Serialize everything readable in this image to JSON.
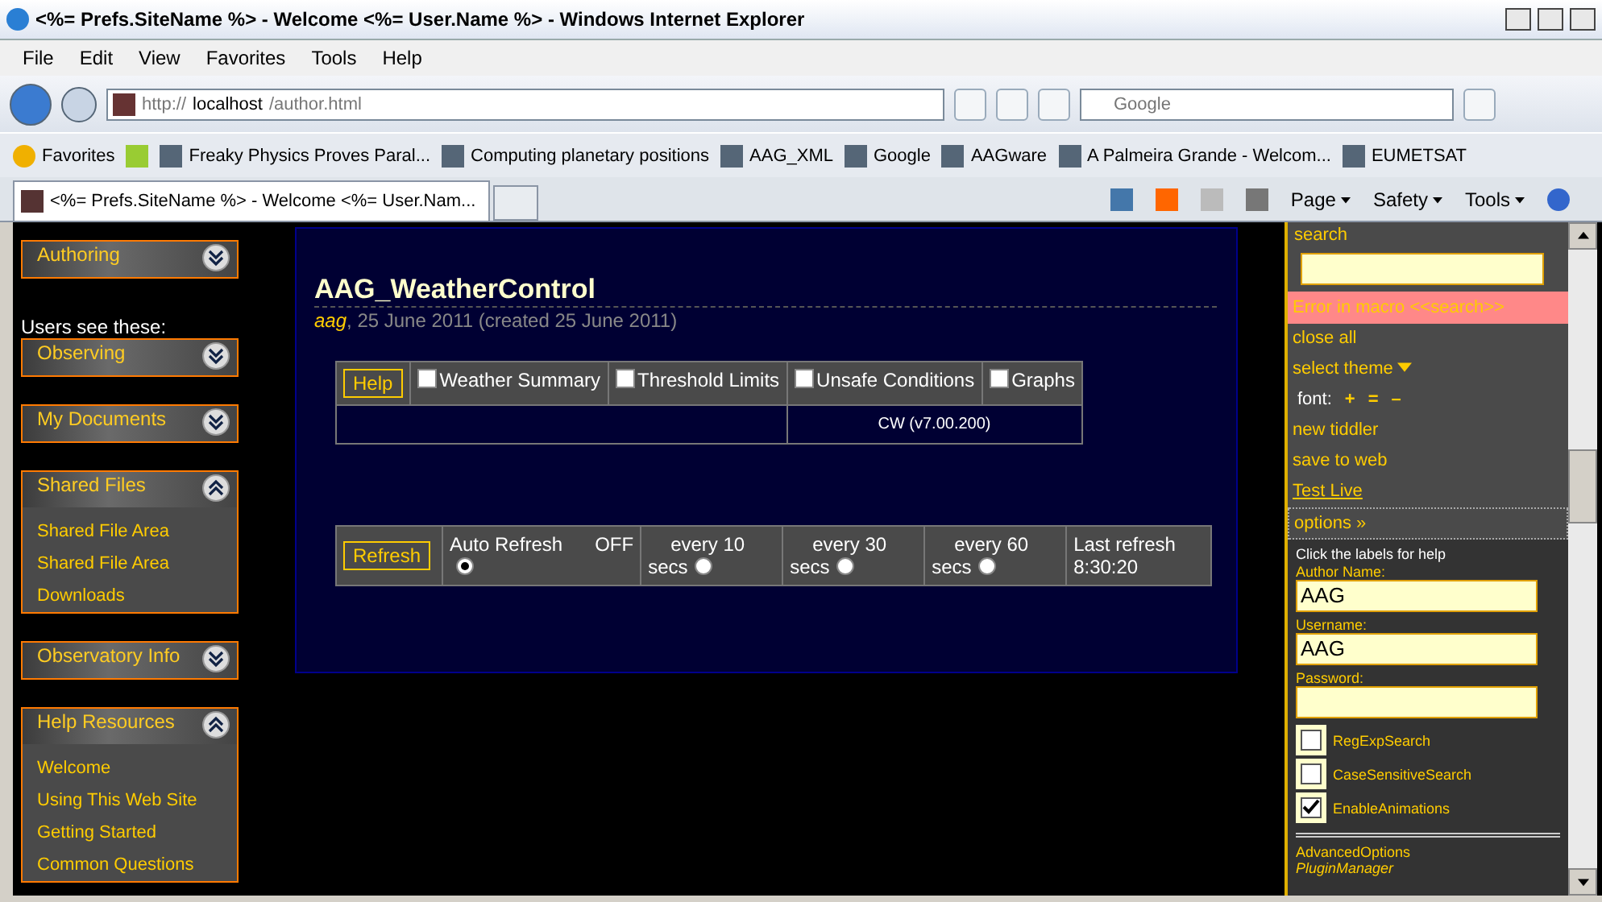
{
  "window": {
    "title": "<%= Prefs.SiteName %> - Welcome <%= User.Name %> - Windows Internet Explorer"
  },
  "menu": [
    "File",
    "Edit",
    "View",
    "Favorites",
    "Tools",
    "Help"
  ],
  "address": {
    "prefix": "http://",
    "host": "localhost",
    "path": "/author.html"
  },
  "search": {
    "placeholder": "Google"
  },
  "favorites": {
    "label": "Favorites",
    "links": [
      {
        "label": "Freaky Physics Proves Paral..."
      },
      {
        "label": "Computing planetary positions"
      },
      {
        "label": "AAG_XML"
      },
      {
        "label": "Google"
      },
      {
        "label": "AAGware"
      },
      {
        "label": "A Palmeira Grande - Welcom..."
      },
      {
        "label": "EUMETSAT"
      }
    ]
  },
  "tabs": [
    {
      "label": "<%= Prefs.SiteName %> - Welcome <%= User.Nam...",
      "selected": true
    }
  ],
  "command_bar": [
    "Page",
    "Safety",
    "Tools"
  ],
  "sidebar": {
    "items": [
      {
        "kind": "section",
        "title": "Authoring",
        "expanded": false
      },
      {
        "kind": "note",
        "text": "Users see these:"
      },
      {
        "kind": "section",
        "title": "Observing",
        "expanded": false
      },
      {
        "kind": "section",
        "title": "My Documents",
        "expanded": false
      },
      {
        "kind": "section",
        "title": "Shared Files",
        "expanded": true,
        "links": [
          "Shared File Area",
          "Shared File Area",
          "Downloads"
        ]
      },
      {
        "kind": "section",
        "title": "Observatory Info",
        "expanded": false
      },
      {
        "kind": "section",
        "title": "Help Resources",
        "expanded": true,
        "links": [
          "Welcome",
          "Using This Web Site",
          "Getting Started",
          "Common Questions"
        ]
      }
    ]
  },
  "tiddler": {
    "title": "AAG_WeatherControl",
    "modifier": "aag",
    "date": ", 25 June 2011 (created 25 June 2011)",
    "help_button": "Help",
    "toggles": [
      {
        "label": "Weather Summary",
        "checked": false
      },
      {
        "label": "Threshold Limits",
        "checked": false
      },
      {
        "label": "Unsafe Conditions",
        "checked": false
      },
      {
        "label": "Graphs",
        "checked": false
      }
    ],
    "version": "CW (v7.00.200)",
    "refresh_button": "Refresh",
    "auto_refresh": {
      "label": "Auto Refresh",
      "state": "OFF",
      "selected": true
    },
    "intervals": [
      {
        "label": "every 10",
        "unit": "secs",
        "selected": false
      },
      {
        "label": "every 30",
        "unit": "secs",
        "selected": false
      },
      {
        "label": "every 60",
        "unit": "secs",
        "selected": false
      }
    ],
    "last_refresh": {
      "label": "Last refresh",
      "time": "8:30:20"
    }
  },
  "right_panel": {
    "search_label": "search",
    "error": "Error in macro <<search>>",
    "links": [
      {
        "kind": "link",
        "label": "close all"
      },
      {
        "kind": "menu",
        "label": "select theme"
      },
      {
        "kind": "font",
        "label": "font:",
        "buttons": [
          "+",
          "=",
          "–"
        ]
      },
      {
        "kind": "link",
        "label": "new tiddler"
      },
      {
        "kind": "link",
        "label": "save to web"
      },
      {
        "kind": "underlined",
        "label": "Test Live"
      },
      {
        "kind": "options",
        "label": "options »"
      }
    ],
    "options": {
      "hint": "Click the labels for help",
      "fields": [
        {
          "label": "Author Name:",
          "value": "AAG"
        },
        {
          "label": "Username:",
          "value": "AAG"
        },
        {
          "label": "Password:"
        }
      ],
      "checkboxes": [
        {
          "label": "RegExpSearch",
          "checked": false
        },
        {
          "label": "CaseSensitiveSearch",
          "checked": false
        },
        {
          "label": "EnableAnimations",
          "checked": true
        }
      ],
      "links": [
        {
          "label": "AdvancedOptions",
          "italic": false
        },
        {
          "label": "PluginManager",
          "italic": true
        }
      ]
    }
  }
}
